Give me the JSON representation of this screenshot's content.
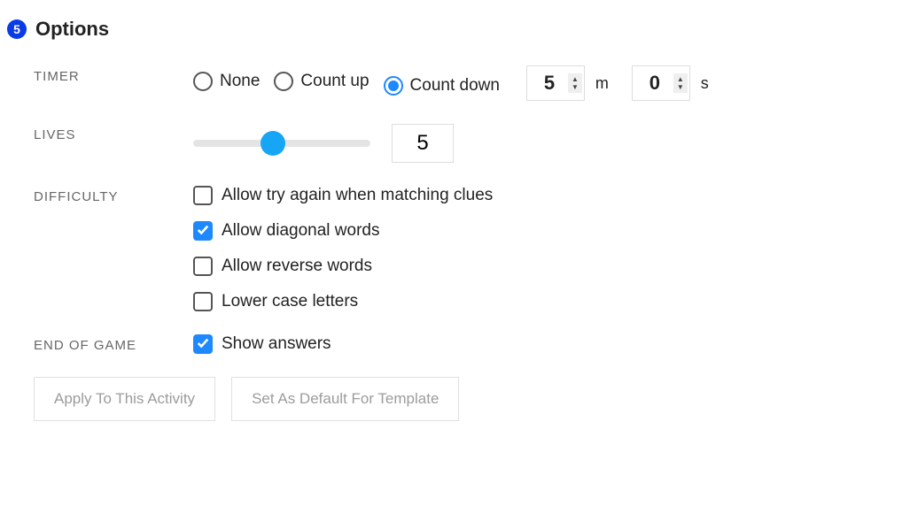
{
  "step": "5",
  "title": "Options",
  "timer": {
    "label": "TIMER",
    "options": [
      {
        "label": "None",
        "selected": false
      },
      {
        "label": "Count up",
        "selected": false
      },
      {
        "label": "Count down",
        "selected": true
      }
    ],
    "minutes": "5",
    "minutes_unit": "m",
    "seconds": "0",
    "seconds_unit": "s"
  },
  "lives": {
    "label": "LIVES",
    "value": "5",
    "slider_percent": 45
  },
  "difficulty": {
    "label": "DIFFICULTY",
    "items": [
      {
        "label": "Allow try again when matching clues",
        "checked": false
      },
      {
        "label": "Allow diagonal words",
        "checked": true
      },
      {
        "label": "Allow reverse words",
        "checked": false
      },
      {
        "label": "Lower case letters",
        "checked": false
      }
    ]
  },
  "end": {
    "label": "END OF GAME",
    "items": [
      {
        "label": "Show answers",
        "checked": true
      }
    ]
  },
  "buttons": {
    "apply": "Apply To This Activity",
    "default": "Set As Default For Template"
  }
}
